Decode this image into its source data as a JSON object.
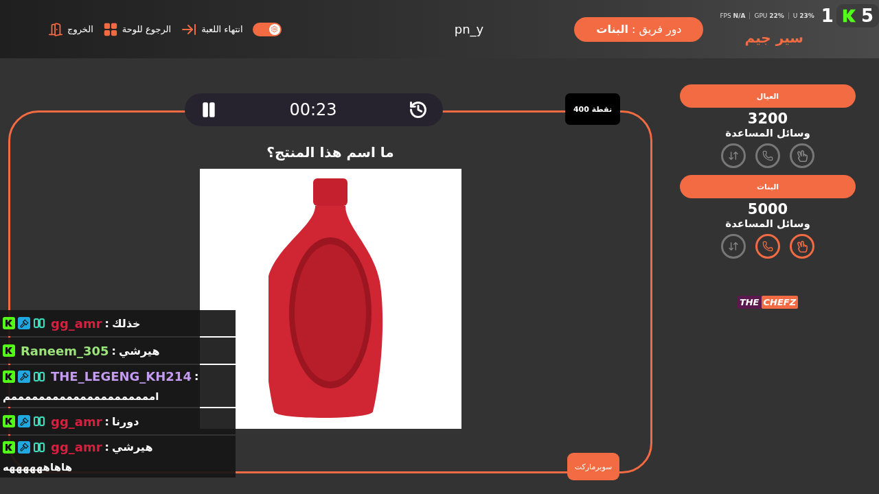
{
  "header": {
    "toolbar": [
      {
        "kind": "toggle",
        "on": true
      },
      {
        "kind": "end",
        "label": "انتهاء اللعبة"
      },
      {
        "kind": "board",
        "label": "الرجوع للوحة"
      },
      {
        "kind": "exit",
        "label": "الخروج"
      }
    ],
    "player": "pn_y",
    "turn": "دور فريق : **البنات**",
    "logo": "سير جيم"
  },
  "stream_overlay": {
    "stats": [
      "U **23%**",
      "GPU **22%**",
      "FPS **N/A**"
    ],
    "viewers": "1",
    "rank": "5"
  },
  "game": {
    "timer": "00:23",
    "points": "400 نقطة",
    "question": "ما اسم هذا المنتج؟",
    "category": "سوبرماركت"
  },
  "teams": [
    {
      "name": "العيال",
      "score": "3200",
      "aids_label": "وسائل المساعدة",
      "lifelines": [
        {
          "kind": "swap",
          "available": false
        },
        {
          "kind": "phone",
          "available": false
        },
        {
          "kind": "peace",
          "available": false
        }
      ]
    },
    {
      "name": "البنات",
      "score": "5000",
      "aids_label": "وسائل المساعدة",
      "lifelines": [
        {
          "kind": "swap",
          "available": false
        },
        {
          "kind": "phone",
          "available": true
        },
        {
          "kind": "peace",
          "available": true
        }
      ]
    }
  ],
  "sponsor": {
    "first": "THE",
    "second": "CHEFZ"
  },
  "chat": [
    {
      "badges": [
        {
          "kind": "k"
        },
        {
          "kind": "mod"
        },
        {
          "kind": "og"
        }
      ],
      "user": "gg_amr",
      "color": "#d4213f",
      "separator": ":",
      "text": "خذلك"
    },
    {
      "badges": [
        {
          "kind": "k"
        }
      ],
      "user": "Raneem_305",
      "color": "#9be37a",
      "separator": ":",
      "text": "هيرشي"
    },
    {
      "badges": [
        {
          "kind": "k"
        },
        {
          "kind": "mod"
        },
        {
          "kind": "og"
        }
      ],
      "user": "THE_LEGENG_KH214",
      "color": "#c39bf0",
      "separator": ":",
      "text_below": "امممممممممممممممممممممم"
    },
    {
      "badges": [
        {
          "kind": "k"
        },
        {
          "kind": "mod"
        },
        {
          "kind": "og"
        }
      ],
      "user": "gg_amr",
      "color": "#d4213f",
      "separator": ":",
      "text": "دورنا"
    },
    {
      "badges": [
        {
          "kind": "k"
        },
        {
          "kind": "mod"
        },
        {
          "kind": "og"
        }
      ],
      "user": "gg_amr",
      "color": "#d4213f",
      "separator": ":",
      "text": "هيرشي",
      "text_below": "هاهاههههههه"
    }
  ]
}
